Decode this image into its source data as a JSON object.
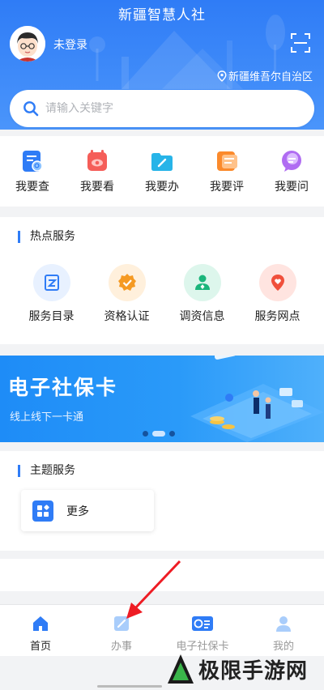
{
  "header": {
    "title": "新疆智慧人社",
    "login_text": "未登录",
    "region": "新疆维吾尔自治区"
  },
  "search": {
    "placeholder": "请输入关键字"
  },
  "quick_items": [
    {
      "label": "我要查",
      "icon": "query-icon",
      "color": "#2f7cf6"
    },
    {
      "label": "我要看",
      "icon": "view-icon",
      "color": "#f55d58"
    },
    {
      "label": "我要办",
      "icon": "handle-icon",
      "color": "#27b4e8"
    },
    {
      "label": "我要评",
      "icon": "review-icon",
      "color": "#fb8a2c"
    },
    {
      "label": "我要问",
      "icon": "ask-icon",
      "color": "#b06cf2"
    }
  ],
  "hot": {
    "title": "热点服务",
    "items": [
      {
        "label": "服务目录",
        "icon": "catalog-icon",
        "color": "#2f7cf6"
      },
      {
        "label": "资格认证",
        "icon": "certification-icon",
        "color": "#f59a23"
      },
      {
        "label": "调资信息",
        "icon": "salary-info-icon",
        "color": "#1bb57b"
      },
      {
        "label": "服务网点",
        "icon": "service-outlet-icon",
        "color": "#f0503c"
      }
    ]
  },
  "banner": {
    "title": "电子社保卡",
    "subtitle": "线上线下一卡通",
    "page_index": 1,
    "page_count": 3
  },
  "theme": {
    "title": "主题服务",
    "more_label": "更多"
  },
  "nav": [
    {
      "label": "首页",
      "icon": "home-icon",
      "active": true
    },
    {
      "label": "办事",
      "icon": "edit-icon",
      "active": false
    },
    {
      "label": "电子社保卡",
      "icon": "social-card-icon",
      "active": false
    },
    {
      "label": "我的",
      "icon": "profile-icon",
      "active": false
    }
  ],
  "watermark": {
    "text": "极限手游网"
  }
}
